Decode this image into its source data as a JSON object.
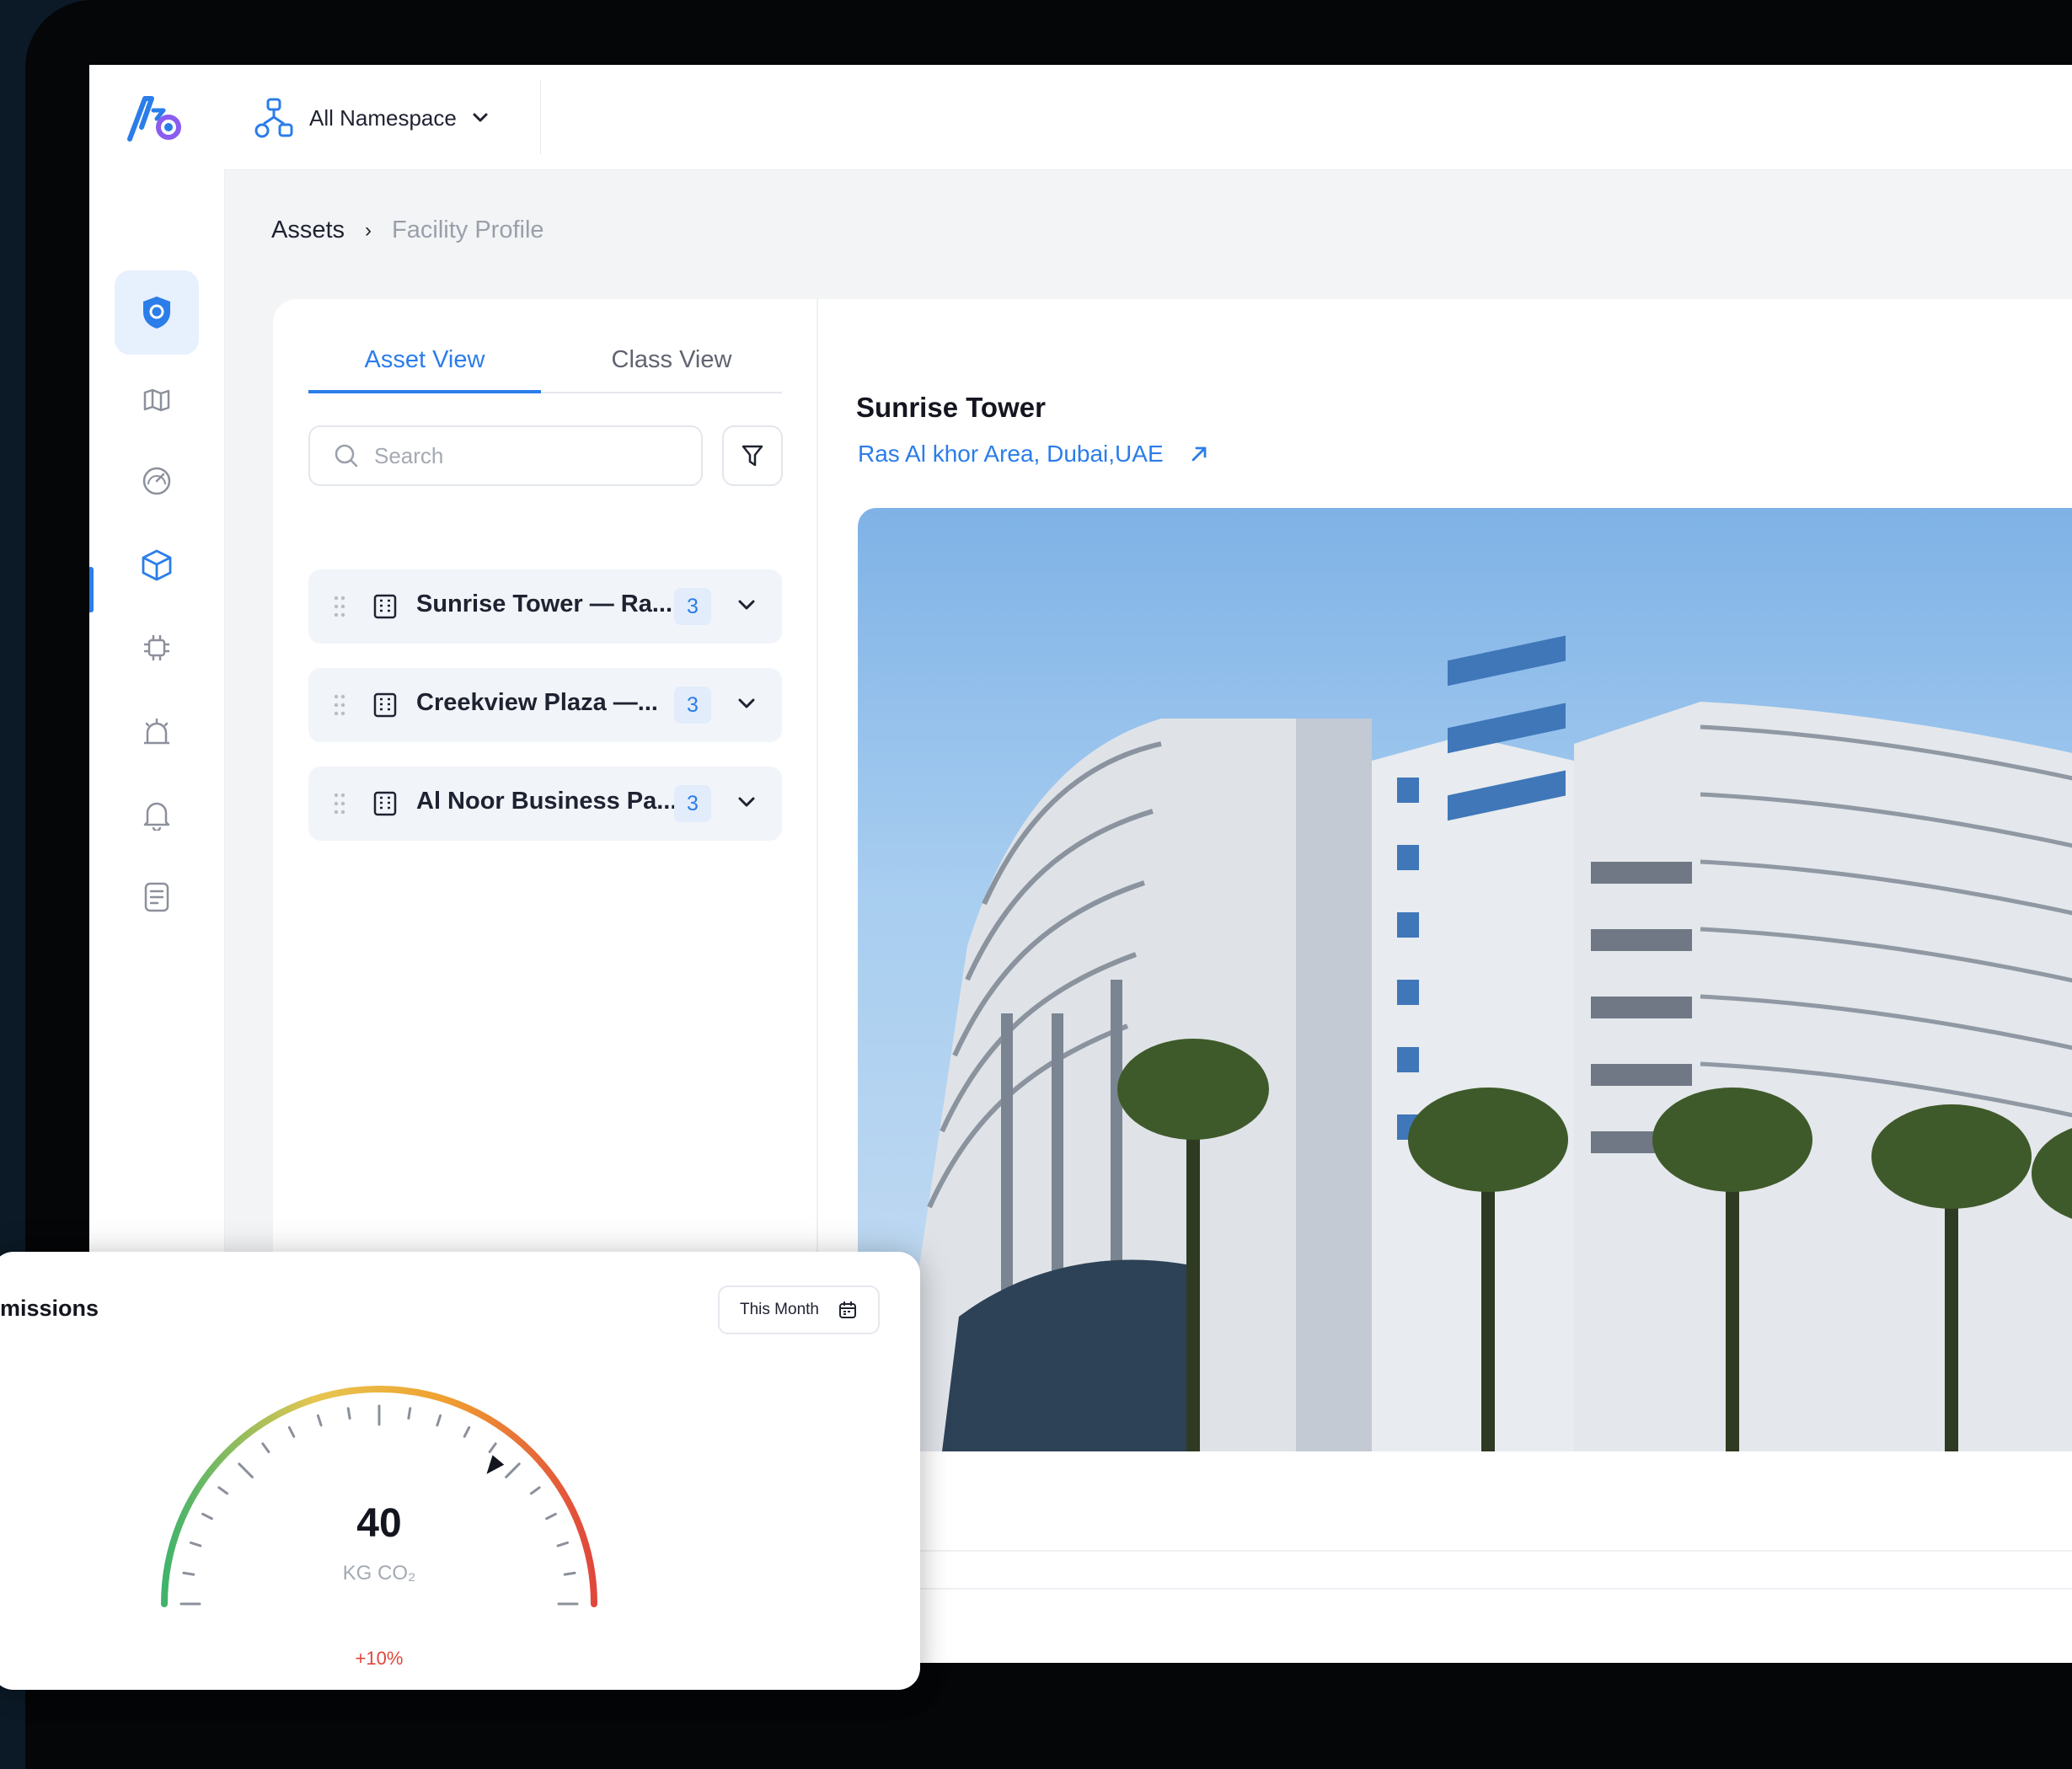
{
  "header": {
    "namespace_label": "All Namespace"
  },
  "breadcrumb": {
    "root": "Assets",
    "separator": "›",
    "current": "Facility Profile"
  },
  "tabs": [
    {
      "label": "Asset View",
      "active": true
    },
    {
      "label": "Class View",
      "active": false
    }
  ],
  "search": {
    "placeholder": "Search",
    "value": ""
  },
  "assets": [
    {
      "name": "Sunrise Tower — Ra...",
      "count": "3"
    },
    {
      "name": "Creekview Plaza —...",
      "count": "3"
    },
    {
      "name": "Al Noor Business Pa...",
      "count": "3"
    }
  ],
  "facility": {
    "title": "Sunrise Tower",
    "location": "Ras Al khor Area, Dubai,UAE"
  },
  "rail_icons": [
    "shield-icon",
    "map-icon",
    "gauge-icon",
    "cube-icon",
    "chip-icon",
    "alarm-icon",
    "bell-icon",
    "document-icon"
  ],
  "emissions": {
    "title": "missions",
    "period": "This Month",
    "value": "40",
    "unit": "KG CO₂",
    "delta": "+10%",
    "gauge_level": 0.72
  },
  "colors": {
    "accent": "#2b7de9",
    "active_bg": "#e7f0fd",
    "gauge_low": "#3fb36b",
    "gauge_mid": "#f0b23a",
    "gauge_high": "#e0473c"
  }
}
